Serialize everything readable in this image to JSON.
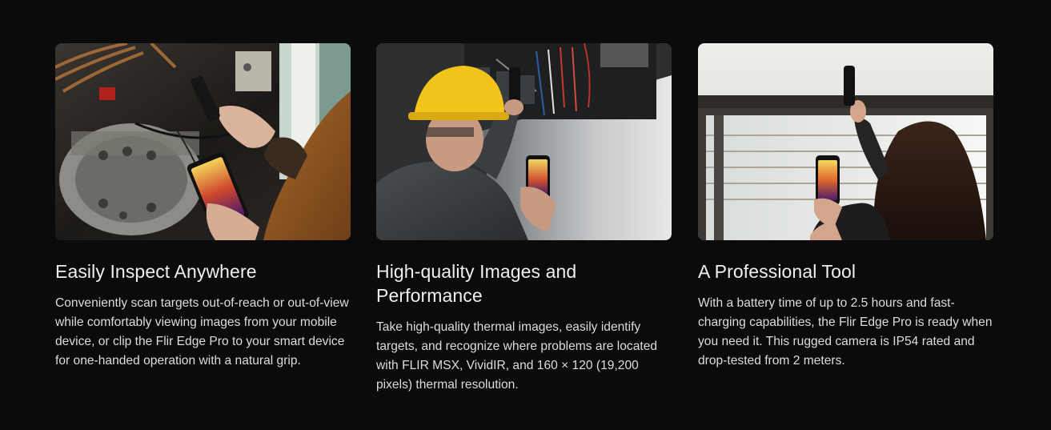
{
  "features": [
    {
      "title": "Easily Inspect Anywhere",
      "description": "Conveniently scan targets out-of-reach or out-of-view while comfortably viewing images from your mobile device, or clip the Flir Edge Pro to your smart device for one-handed operation with a natural grip.",
      "image_icon": "technician-inspecting-hvac-unit-photo"
    },
    {
      "title": "High-quality Images and Performance",
      "description": "Take high-quality thermal images, easily identify targets, and recognize where problems are located with FLIR MSX, VividIR, and 160 × 120 (19,200 pixels) thermal resolution.",
      "image_icon": "electrician-hardhat-inspecting-panel-photo"
    },
    {
      "title": "A Professional Tool",
      "description": "With a battery time of up to 2.5 hours and fast-charging capabilities, the Flir Edge Pro is ready when you need it. This rugged camera is IP54 rated and drop-tested from 2 meters.",
      "image_icon": "woman-scanning-window-frame-photo"
    }
  ],
  "colors": {
    "background": "#0b0b0b",
    "title": "#efefef",
    "text": "#dcdcdc"
  }
}
